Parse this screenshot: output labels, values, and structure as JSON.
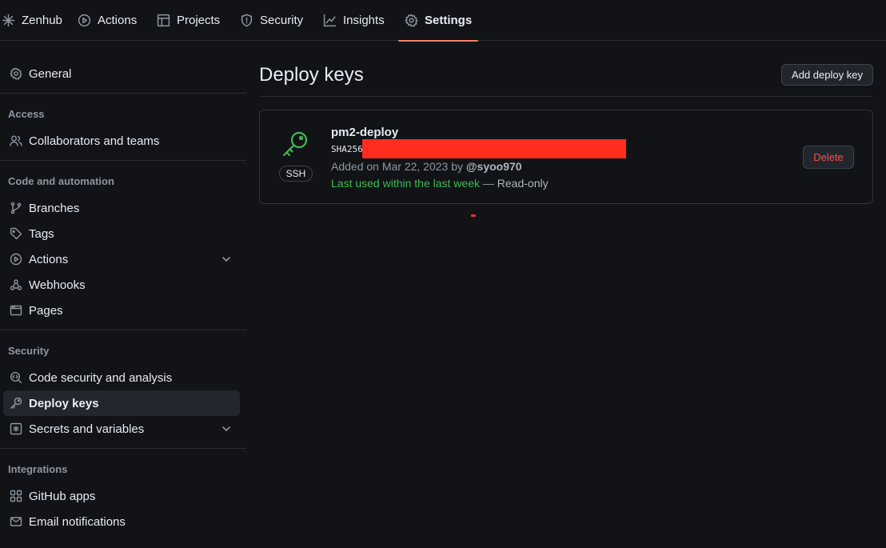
{
  "topnav": {
    "tabs": [
      {
        "label": "Zenhub",
        "icon": "zenhub-icon"
      },
      {
        "label": "Actions",
        "icon": "play-circle-icon"
      },
      {
        "label": "Projects",
        "icon": "table-icon"
      },
      {
        "label": "Security",
        "icon": "shield-icon"
      },
      {
        "label": "Insights",
        "icon": "graph-icon"
      },
      {
        "label": "Settings",
        "icon": "gear-icon",
        "active": true
      }
    ]
  },
  "sidebar": {
    "general": "General",
    "access_header": "Access",
    "collaborators": "Collaborators and teams",
    "code_header": "Code and automation",
    "branches": "Branches",
    "tags": "Tags",
    "actions": "Actions",
    "webhooks": "Webhooks",
    "pages": "Pages",
    "security_header": "Security",
    "code_security": "Code security and analysis",
    "deploy_keys": "Deploy keys",
    "secrets": "Secrets and variables",
    "integrations_header": "Integrations",
    "github_apps": "GitHub apps",
    "email_notifications": "Email notifications"
  },
  "main": {
    "title": "Deploy keys",
    "add_button": "Add deploy key",
    "keys": [
      {
        "name": "pm2-deploy",
        "badge": "SSH",
        "fingerprint": "SHA256",
        "added_prefix": "Added on Mar 22, 2023 by",
        "added_by": "@syoo970",
        "last_used": "Last used within the last week",
        "separator": " — ",
        "access": "Read-only",
        "delete_label": "Delete"
      }
    ]
  },
  "colors": {
    "background": "#111317",
    "accent_underline": "#f78166",
    "success_green": "#3fb950",
    "danger_red": "#f85149",
    "redaction": "#ff2d1e"
  }
}
